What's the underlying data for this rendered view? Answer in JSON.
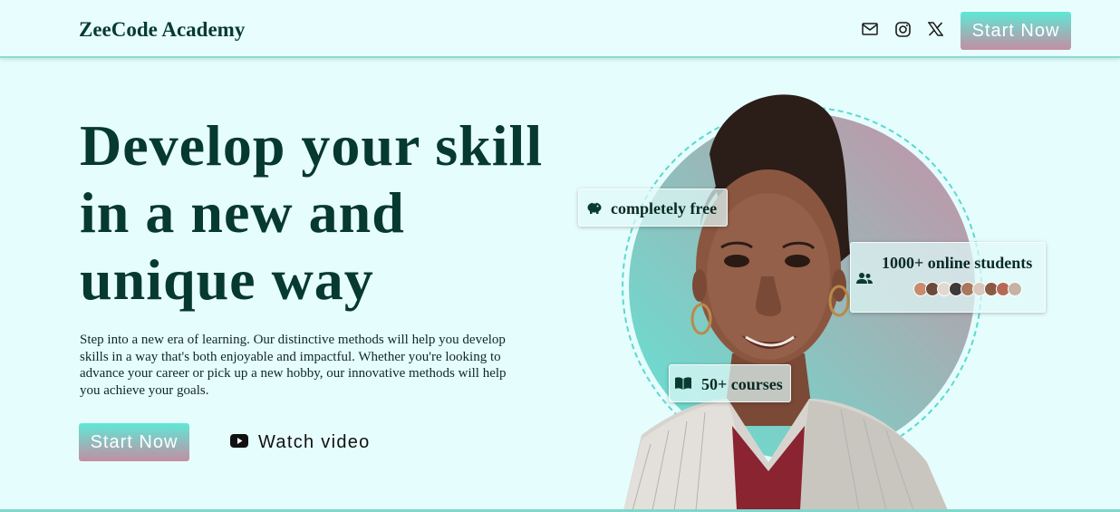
{
  "header": {
    "logo": "ZeeCode Academy",
    "icons": [
      "mail-icon",
      "instagram-icon",
      "x-icon"
    ],
    "cta_label": "Start Now"
  },
  "hero": {
    "title": "Develop your skill in a new and unique way",
    "description": "Step into a new era of learning. Our distinctive methods will help you develop skills in a way that's both enjoyable and impactful. Whether you're looking to advance your career or pick up a new hobby, our innovative methods will help you achieve your goals.",
    "cta_label": "Start Now",
    "watch_label": "Watch video"
  },
  "badges": {
    "free": "completely free",
    "students": "1000+ online students",
    "courses": "50+ courses"
  },
  "colors": {
    "accent_teal": "#5fe8d6",
    "accent_pink": "#c38ea3",
    "text_dark": "#063b32",
    "background": "#e6fdfd"
  }
}
